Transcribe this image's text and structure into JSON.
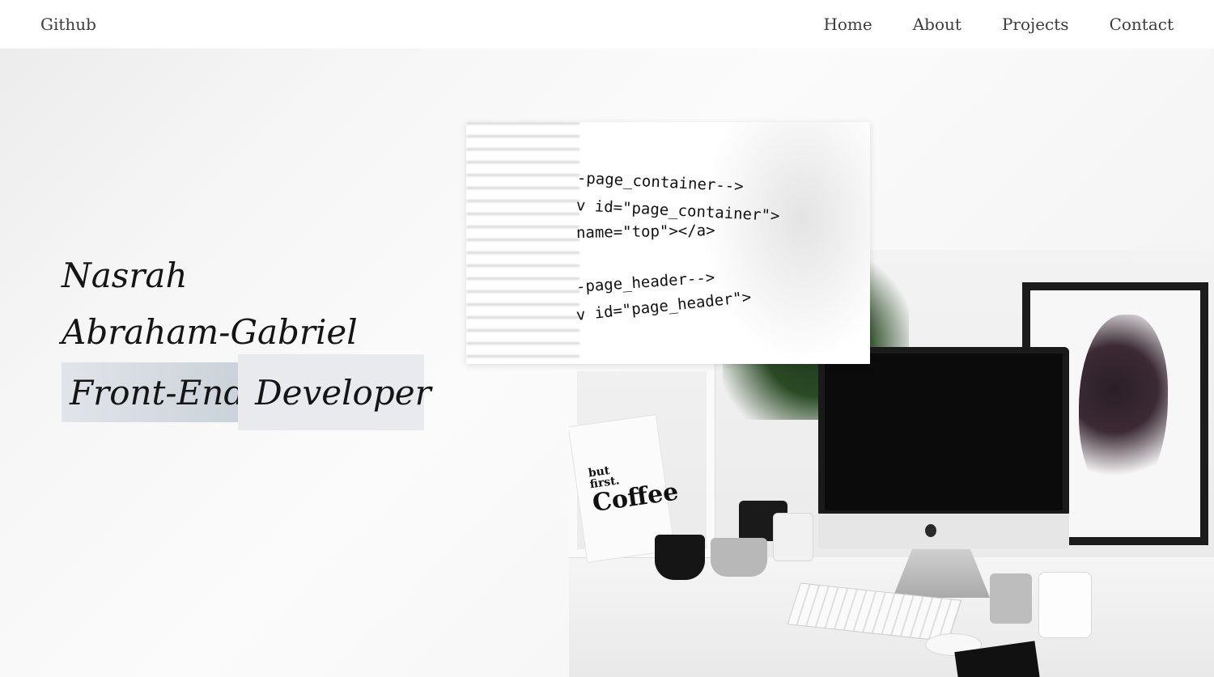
{
  "nav": {
    "brand": "Github",
    "links": [
      "Home",
      "About",
      "Projects",
      "Contact"
    ]
  },
  "hero": {
    "first_name": "Nasrah",
    "last_name": "Abraham-Gabriel",
    "role_part1": "Front-End",
    "role_part2": "Developer"
  },
  "images": {
    "code": {
      "lines": [
        "-page_container-->",
        "v id=\"page_container\">",
        "name=\"top\"></a>",
        "-page_header-->",
        "v id=\"page_header\">"
      ]
    },
    "desk": {
      "poster_line1": "but",
      "poster_line2": "first.",
      "poster_line3": "Coffee"
    }
  }
}
